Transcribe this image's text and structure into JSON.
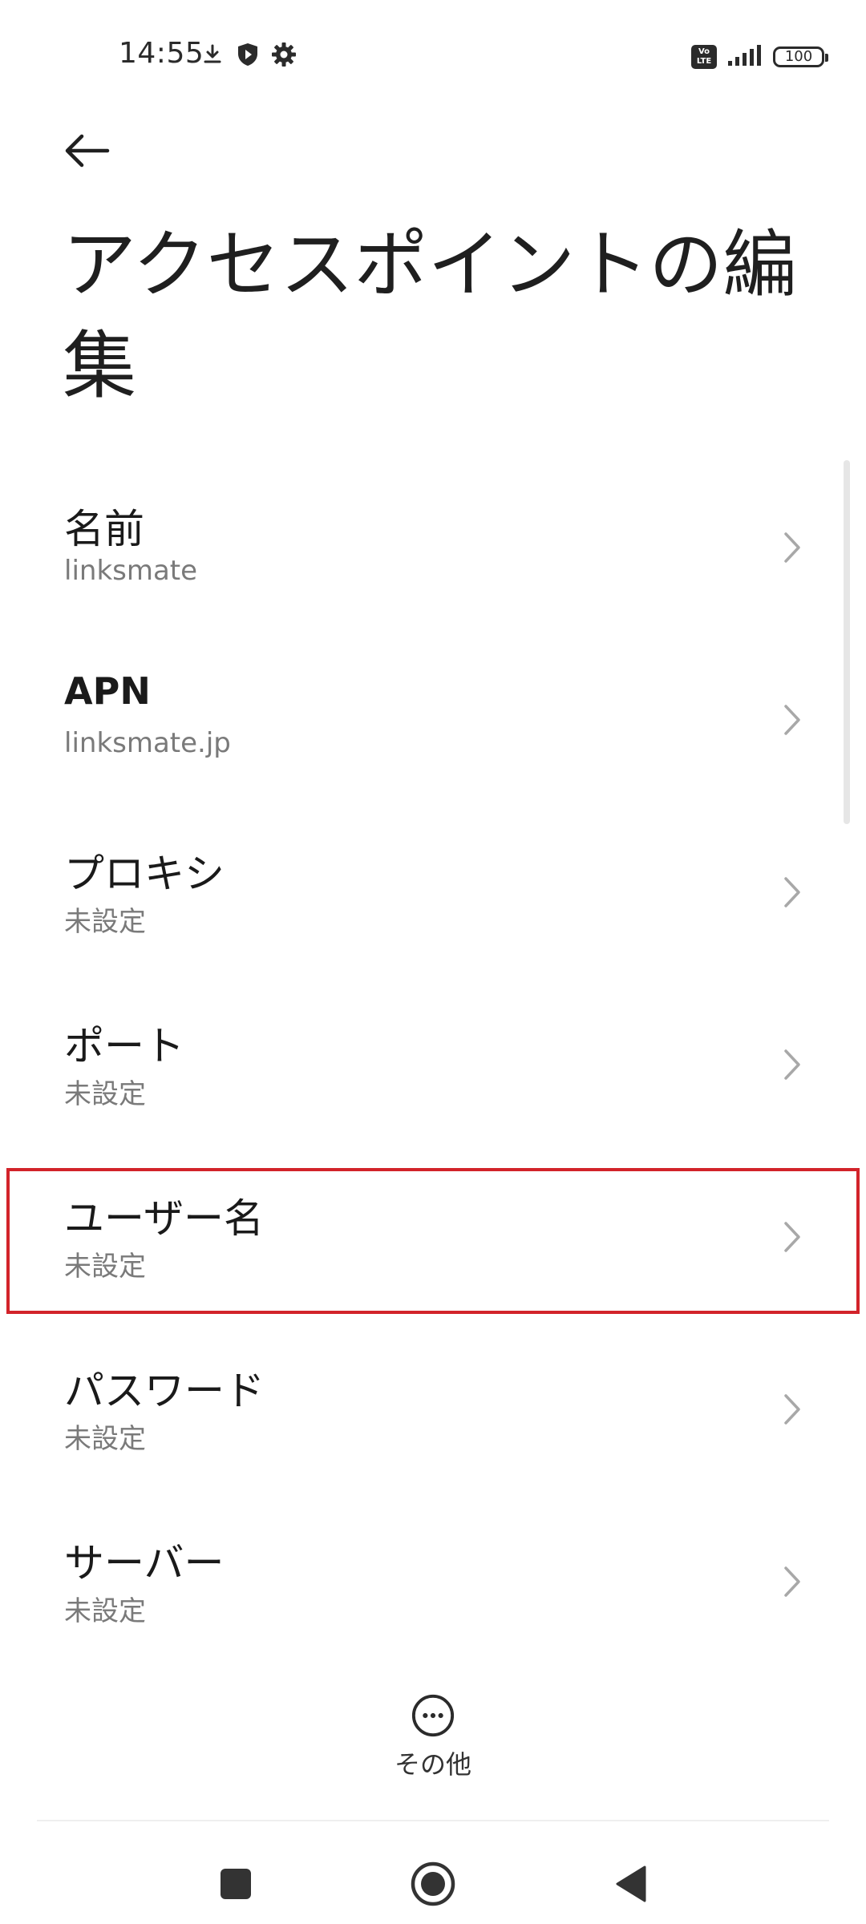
{
  "status_bar": {
    "time": "14:55",
    "left_icons": [
      "download-icon",
      "shield-play-icon",
      "gear-icon"
    ],
    "volte_top": "Vo",
    "volte_bottom": "LTE",
    "battery_level": "100"
  },
  "header": {
    "back_icon": "arrow-left-icon",
    "title": "アクセスポイントの編集"
  },
  "settings": {
    "items": [
      {
        "label": "名前",
        "value": "linksmate"
      },
      {
        "label": "APN",
        "value": "linksmate.jp"
      },
      {
        "label": "プロキシ",
        "value": "未設定"
      },
      {
        "label": "ポート",
        "value": "未設定"
      },
      {
        "label": "ユーザー名",
        "value": "未設定"
      },
      {
        "label": "パスワード",
        "value": "未設定"
      },
      {
        "label": "サーバー",
        "value": "未設定"
      }
    ],
    "highlighted_index": 4,
    "highlight_color": "#d2232a"
  },
  "footer": {
    "more_label": "その他",
    "more_icon": "more-horizontal-icon"
  },
  "nav_bar": {
    "buttons": [
      "recents-square-icon",
      "home-circle-icon",
      "back-triangle-icon"
    ]
  }
}
